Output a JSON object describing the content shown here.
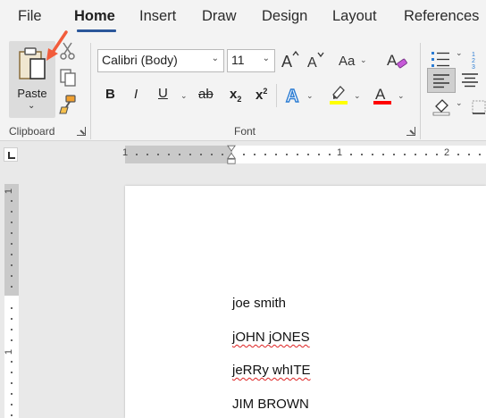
{
  "menu": {
    "tabs": [
      "File",
      "Home",
      "Insert",
      "Draw",
      "Design",
      "Layout",
      "References"
    ],
    "active_tab": "Home"
  },
  "clipboard": {
    "paste_label": "Paste",
    "group_label": "Clipboard"
  },
  "font": {
    "font_name": "Calibri (Body)",
    "font_size": "11",
    "bold": "B",
    "italic": "I",
    "underline": "U",
    "strike": "ab",
    "subscript": "x",
    "subscript_mark": "2",
    "superscript": "x",
    "superscript_mark": "2",
    "group_label": "Font",
    "highlight_color": "#ffff00",
    "font_color": "#ff0000"
  },
  "ruler": {
    "h_numbers": [
      "1",
      "1",
      "2"
    ],
    "v_numbers": [
      "1",
      "1"
    ]
  },
  "document": {
    "lines": [
      "joe smith",
      "jOHN jONES",
      "jeRRy whITE",
      "JIM BROWN"
    ]
  },
  "colors": {
    "accent": "#2b579a",
    "annotation_arrow": "#f25c3b"
  }
}
